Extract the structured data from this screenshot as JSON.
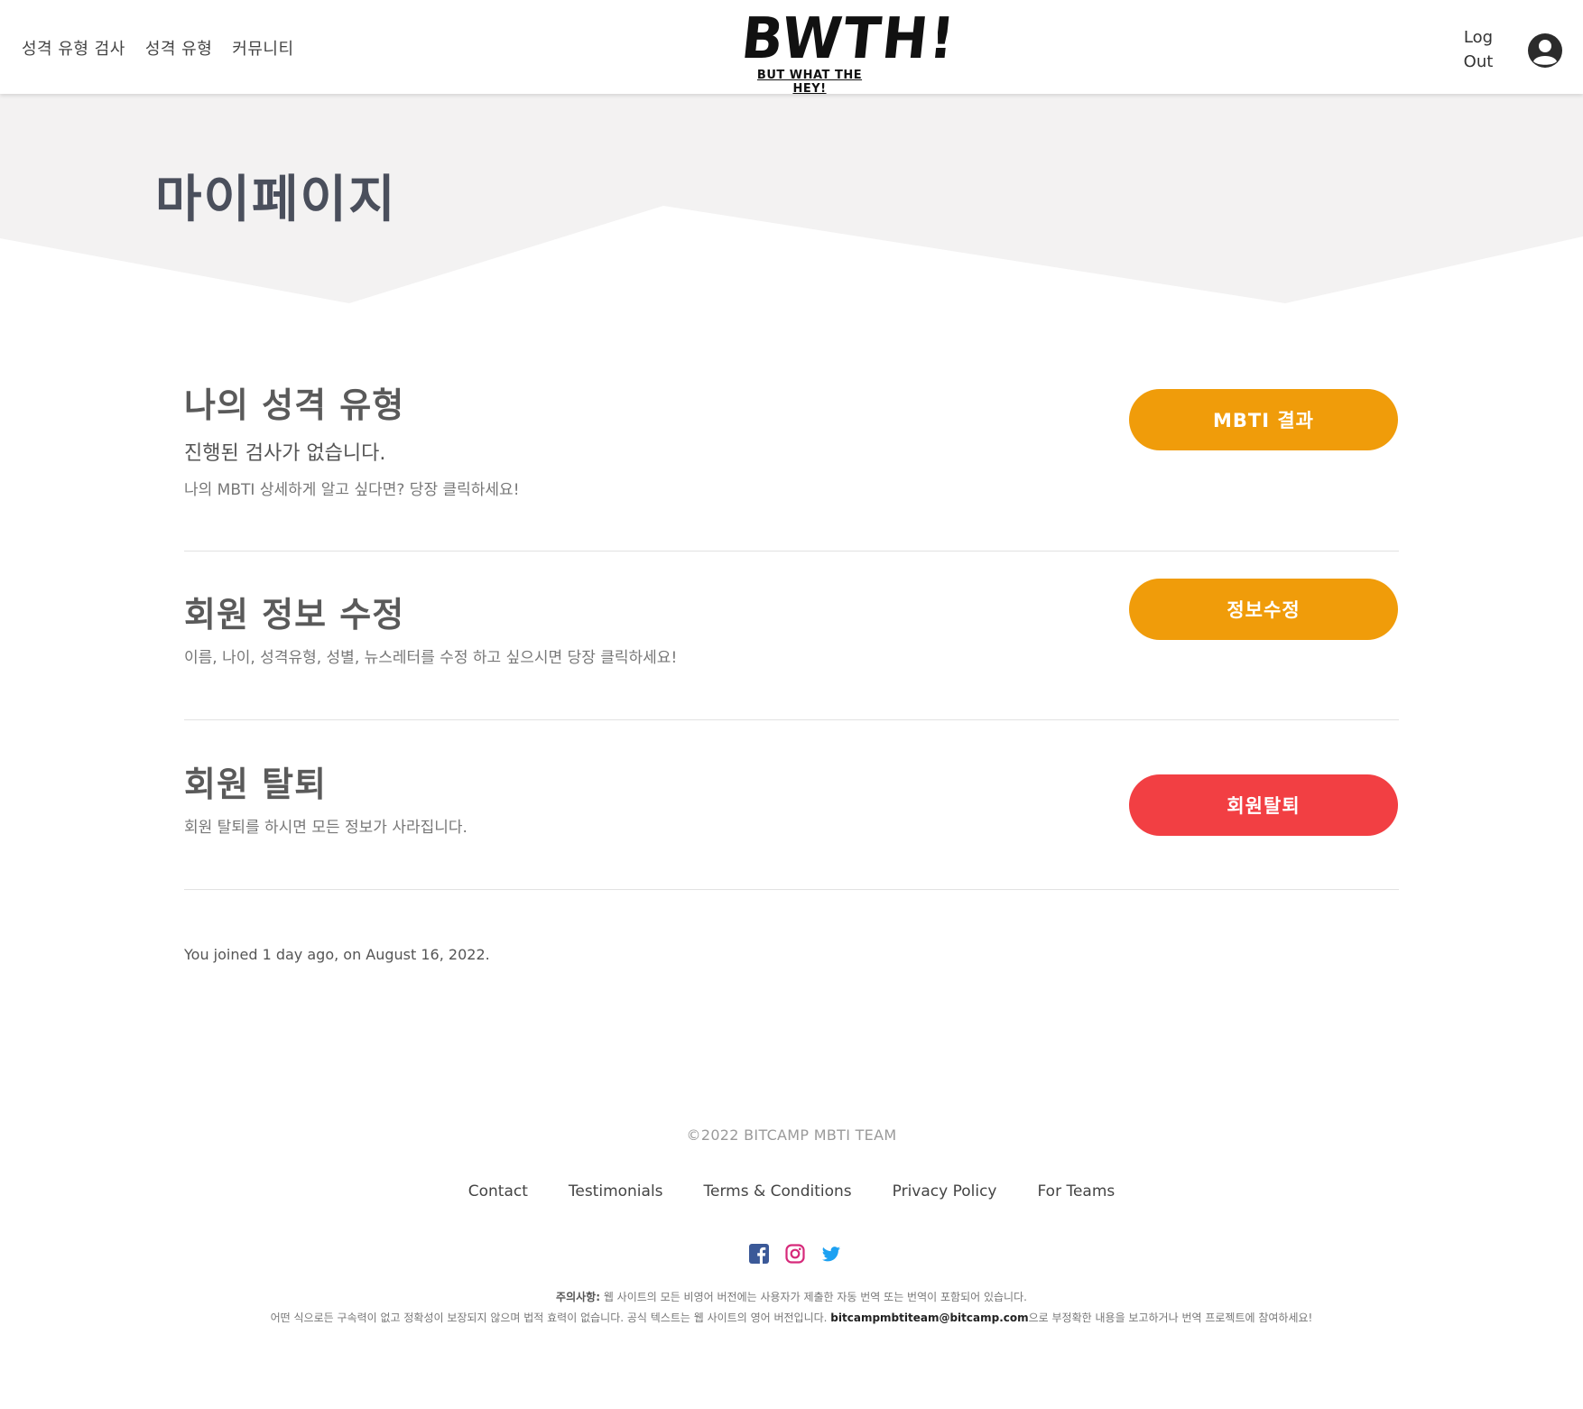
{
  "header": {
    "nav": [
      "성격 유형 검사",
      "성격 유형",
      "커뮤니티"
    ],
    "logo_main": "BWTH!",
    "logo_sub": "BUT WHAT THE HEY!",
    "logout_line1": "Log",
    "logout_line2": "Out"
  },
  "hero": {
    "title": "마이페이지"
  },
  "sections": [
    {
      "title": "나의 성격 유형",
      "subtitle": "진행된 검사가 없습니다.",
      "description": "나의 MBTI 상세하게 알고 싶다면? 당장 클릭하세요!",
      "button": "MBTI 결과",
      "button_color": "#f09c0a"
    },
    {
      "title": "회원 정보 수정",
      "description": "이름, 나이, 성격유형, 성별, 뉴스레터를 수정 하고 싶으시면 당장 클릭하세요!",
      "button": "정보수정",
      "button_color": "#f09c0a"
    },
    {
      "title": "회원 탈퇴",
      "description": "회원 탈퇴를 하시면 모든 정보가 사라집니다.",
      "button": "회원탈퇴",
      "button_color": "#f23f43"
    }
  ],
  "joined": "You joined 1 day ago, on August 16, 2022.",
  "footer": {
    "copyright": "©2022 BITCAMP MBTI TEAM",
    "links": [
      "Contact",
      "Testimonials",
      "Terms & Conditions",
      "Privacy Policy",
      "For Teams"
    ],
    "social_icons": [
      "facebook-icon",
      "instagram-icon",
      "twitter-icon"
    ],
    "disclaimer_label": "주의사항:",
    "disclaimer_line1": " 웹 사이트의 모든 비영어 버전에는 사용자가 제출한 자동 번역 또는 번역이 포함되어 있습니다.",
    "disclaimer_line2a": "어떤 식으로든 구속력이 없고 정확성이 보장되지 않으며 법적 효력이 없습니다. 공식 텍스트는 웹 사이트의 영어 버전입니다. ",
    "disclaimer_email": "bitcampmbtiteam@bitcamp.com",
    "disclaimer_line2b": "으로 부정확한 내용을 보고하거나 번역 프로젝트에 참여하세요!"
  }
}
